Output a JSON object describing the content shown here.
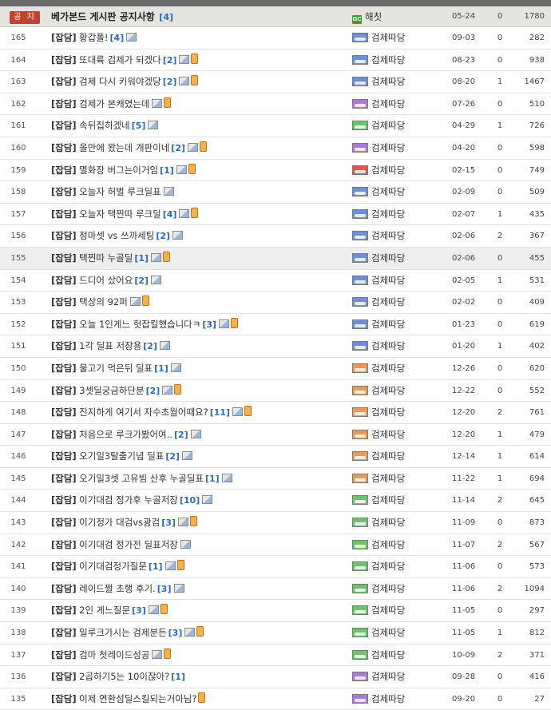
{
  "notice": {
    "badge": "공 지",
    "title": "베가본드 게시판 공지사항",
    "comments": "[4]",
    "author": "해칫",
    "author_icon": "gc-icon",
    "date": "05-24",
    "comment_count": "0",
    "views": "1780"
  },
  "posts": [
    {
      "num": "165",
      "cat": "[잡담]",
      "title": "황갑폴!",
      "cnt": "[4]",
      "img": true,
      "mob": false,
      "author": "검제따당",
      "lvl": "blue",
      "date": "09-03",
      "c": "0",
      "views": "282"
    },
    {
      "num": "164",
      "cat": "[잡담]",
      "title": "또대륙 검제가 되겠다",
      "cnt": "[2]",
      "img": true,
      "mob": true,
      "author": "검제따당",
      "lvl": "blue",
      "date": "08-23",
      "c": "0",
      "views": "938"
    },
    {
      "num": "163",
      "cat": "[잡담]",
      "title": "검제 다시 키워야겠당",
      "cnt": "[2]",
      "img": true,
      "mob": true,
      "author": "검제따당",
      "lvl": "blue",
      "date": "08-20",
      "c": "1",
      "views": "1467"
    },
    {
      "num": "162",
      "cat": "[잡담]",
      "title": "검제가 본캐였는데",
      "cnt": "",
      "img": true,
      "mob": true,
      "author": "검제따당",
      "lvl": "purple",
      "date": "07-26",
      "c": "0",
      "views": "510"
    },
    {
      "num": "161",
      "cat": "[잡담]",
      "title": "속뒤집히겠네",
      "cnt": "[5]",
      "img": true,
      "mob": false,
      "author": "검제따당",
      "lvl": "green",
      "date": "04-29",
      "c": "1",
      "views": "726"
    },
    {
      "num": "160",
      "cat": "[잡담]",
      "title": "올만에 왔는데 개판이네",
      "cnt": "[2]",
      "img": true,
      "mob": true,
      "author": "검제따당",
      "lvl": "purple",
      "date": "04-20",
      "c": "0",
      "views": "598"
    },
    {
      "num": "159",
      "cat": "[잡담]",
      "title": "멸화장 버그는이거임",
      "cnt": "[1]",
      "img": true,
      "mob": true,
      "author": "검제따당",
      "lvl": "red",
      "date": "02-15",
      "c": "0",
      "views": "749"
    },
    {
      "num": "158",
      "cat": "[잡담]",
      "title": "오늘자 허벌 루크딜표",
      "cnt": "",
      "img": true,
      "mob": false,
      "author": "검제따당",
      "lvl": "blue",
      "date": "02-09",
      "c": "0",
      "views": "509"
    },
    {
      "num": "157",
      "cat": "[잡담]",
      "title": "오늘자 택찐따 루크딜",
      "cnt": "[4]",
      "img": true,
      "mob": true,
      "author": "검제따당",
      "lvl": "blue",
      "date": "02-07",
      "c": "1",
      "views": "435"
    },
    {
      "num": "156",
      "cat": "[잡담]",
      "title": "정마셋 vs 쓰까세팅",
      "cnt": "[2]",
      "img": true,
      "mob": false,
      "author": "검제따당",
      "lvl": "blue",
      "date": "02-06",
      "c": "2",
      "views": "367"
    },
    {
      "num": "155",
      "cat": "[잡담]",
      "title": "택찐따 누골딜",
      "cnt": "[1]",
      "img": true,
      "mob": true,
      "author": "검제따당",
      "lvl": "blue",
      "date": "02-06",
      "c": "0",
      "views": "455",
      "hl": true
    },
    {
      "num": "154",
      "cat": "[잡담]",
      "title": "드디어 샀어요",
      "cnt": "[2]",
      "img": true,
      "mob": false,
      "author": "검제따당",
      "lvl": "blue",
      "date": "02-05",
      "c": "1",
      "views": "531"
    },
    {
      "num": "153",
      "cat": "[잡담]",
      "title": "택상의 92퍼",
      "cnt": "",
      "img": true,
      "mob": true,
      "author": "검제따당",
      "lvl": "blue",
      "date": "02-02",
      "c": "0",
      "views": "409"
    },
    {
      "num": "152",
      "cat": "[잡담]",
      "title": "오늘 1인게느 헛잡킬했습니다ㅋ",
      "cnt": "[3]",
      "img": true,
      "mob": true,
      "author": "검제따당",
      "lvl": "blue",
      "date": "01-23",
      "c": "0",
      "views": "619"
    },
    {
      "num": "151",
      "cat": "[잡담]",
      "title": "1각 딜표 저장용",
      "cnt": "[2]",
      "img": true,
      "mob": false,
      "author": "검제따당",
      "lvl": "blue",
      "date": "01-20",
      "c": "1",
      "views": "402"
    },
    {
      "num": "150",
      "cat": "[잡담]",
      "title": "물고기 먹은뒤 딜표",
      "cnt": "[1]",
      "img": true,
      "mob": false,
      "author": "검제따당",
      "lvl": "orange",
      "date": "12-26",
      "c": "0",
      "views": "620"
    },
    {
      "num": "149",
      "cat": "[잡담]",
      "title": "3셋딜궁금하단분",
      "cnt": "[2]",
      "img": true,
      "mob": true,
      "author": "검제따당",
      "lvl": "orange",
      "date": "12-22",
      "c": "0",
      "views": "552"
    },
    {
      "num": "148",
      "cat": "[잡담]",
      "title": "진지하게 여기서 자수초월어때요?",
      "cnt": "[11]",
      "img": true,
      "mob": true,
      "author": "검제따당",
      "lvl": "orange",
      "date": "12-20",
      "c": "2",
      "views": "761"
    },
    {
      "num": "147",
      "cat": "[잡담]",
      "title": "처음으로 루크가봤어여..",
      "cnt": "[2]",
      "img": true,
      "mob": false,
      "author": "검제따당",
      "lvl": "orange",
      "date": "12-20",
      "c": "1",
      "views": "479"
    },
    {
      "num": "146",
      "cat": "[잡담]",
      "title": "오기일3탈출기념 딜표",
      "cnt": "[2]",
      "img": true,
      "mob": false,
      "author": "검제따당",
      "lvl": "orange",
      "date": "12-14",
      "c": "1",
      "views": "614"
    },
    {
      "num": "145",
      "cat": "[잡담]",
      "title": "오기일3셋 고유빔 산후 누골딜표",
      "cnt": "[1]",
      "img": true,
      "mob": false,
      "author": "검제따당",
      "lvl": "orange",
      "date": "11-22",
      "c": "1",
      "views": "694"
    },
    {
      "num": "144",
      "cat": "[잡담]",
      "title": "이기대검 정가후 누골저장",
      "cnt": "[10]",
      "img": true,
      "mob": false,
      "author": "검제따당",
      "lvl": "green",
      "date": "11-14",
      "c": "2",
      "views": "645"
    },
    {
      "num": "143",
      "cat": "[잡담]",
      "title": "이기정가 대검vs광검",
      "cnt": "[3]",
      "img": true,
      "mob": true,
      "author": "검제따당",
      "lvl": "green",
      "date": "11-09",
      "c": "0",
      "views": "873"
    },
    {
      "num": "142",
      "cat": "[잡담]",
      "title": "이기대검 정가전 딜표저장",
      "cnt": "",
      "img": true,
      "mob": false,
      "author": "검제따당",
      "lvl": "green",
      "date": "11-07",
      "c": "2",
      "views": "567"
    },
    {
      "num": "141",
      "cat": "[잡담]",
      "title": "이기대검정가질문",
      "cnt": "[1]",
      "img": true,
      "mob": true,
      "author": "검제따당",
      "lvl": "green",
      "date": "11-06",
      "c": "0",
      "views": "573"
    },
    {
      "num": "140",
      "cat": "[잡담]",
      "title": "레이드쩔 초행 후기.",
      "cnt": "[3]",
      "img": true,
      "mob": false,
      "author": "검제따당",
      "lvl": "green",
      "date": "11-06",
      "c": "2",
      "views": "1094"
    },
    {
      "num": "139",
      "cat": "[잡담]",
      "title": "2인 게느질문",
      "cnt": "[3]",
      "img": true,
      "mob": true,
      "author": "검제따당",
      "lvl": "green",
      "date": "11-05",
      "c": "0",
      "views": "297"
    },
    {
      "num": "138",
      "cat": "[잡담]",
      "title": "일루크가시는 검제분든",
      "cnt": "[3]",
      "img": true,
      "mob": true,
      "author": "검제따당",
      "lvl": "green",
      "date": "11-05",
      "c": "1",
      "views": "812"
    },
    {
      "num": "137",
      "cat": "[잡담]",
      "title": "검마 첫레이드성공",
      "cnt": "",
      "img": true,
      "mob": true,
      "author": "검제따당",
      "lvl": "green",
      "date": "10-09",
      "c": "2",
      "views": "371"
    },
    {
      "num": "136",
      "cat": "[잡담]",
      "title": "2곱하기5는 10이잖아?",
      "cnt": "[1]",
      "img": false,
      "mob": false,
      "author": "검제따당",
      "lvl": "purple",
      "date": "09-28",
      "c": "0",
      "views": "416"
    },
    {
      "num": "135",
      "cat": "[잡담]",
      "title": "이제 연환섬딜스킬되는거아님?",
      "cnt": "",
      "img": false,
      "mob": true,
      "author": "검제따당",
      "lvl": "purple",
      "date": "09-20",
      "c": "0",
      "views": "27"
    }
  ]
}
